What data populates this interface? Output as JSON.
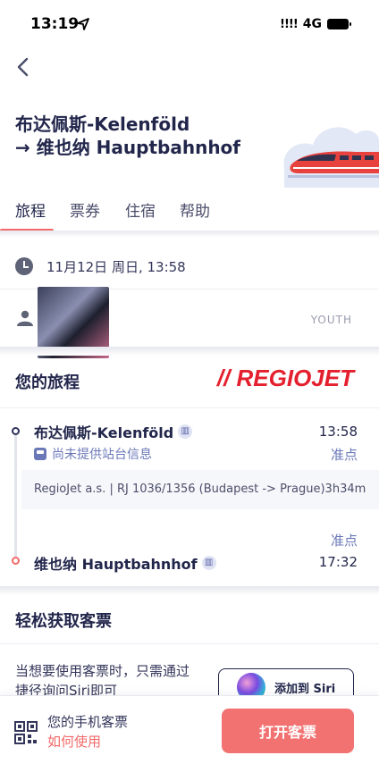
{
  "status_bar": {
    "time": "13:19",
    "signal": "!!!!",
    "network": "4G"
  },
  "route": {
    "from": "布达佩斯-Kelenföld",
    "to": "→ 维也纳 Hauptbahnhof"
  },
  "tabs": [
    {
      "label": "旅程",
      "active": true
    },
    {
      "label": "票券",
      "active": false
    },
    {
      "label": "住宿",
      "active": false
    },
    {
      "label": "帮助",
      "active": false
    }
  ],
  "trip": {
    "datetime": "11月12日 周日, 13:58",
    "passenger_type": "YOUTH"
  },
  "journey": {
    "title": "您的旅程",
    "carrier_logo": "// REGIOJET",
    "departure": {
      "station": "布达佩斯-Kelenföld",
      "time": "13:58",
      "status": "准点",
      "platform_info": "尚未提供站台信息"
    },
    "service": "RegioJet a.s. | RJ 1036/1356 (Budapest -> Prague)3h34m",
    "arrival": {
      "station": "维也纳 Hauptbahnhof",
      "time": "17:32",
      "status": "准点"
    }
  },
  "easy_access": {
    "title": "轻松获取客票",
    "siri_text": "当想要使用客票时，只需通过捷径询问Siri即可",
    "siri_button": "添加到 Siri"
  },
  "bottom_bar": {
    "mobile_ticket": "您的手机客票",
    "how_to": "如何使用",
    "open_button": "打开客票"
  },
  "colors": {
    "accent": "#f26a6a",
    "navy": "#22264b",
    "link_blue": "#6b78b8",
    "brand_red": "#e4202e"
  }
}
